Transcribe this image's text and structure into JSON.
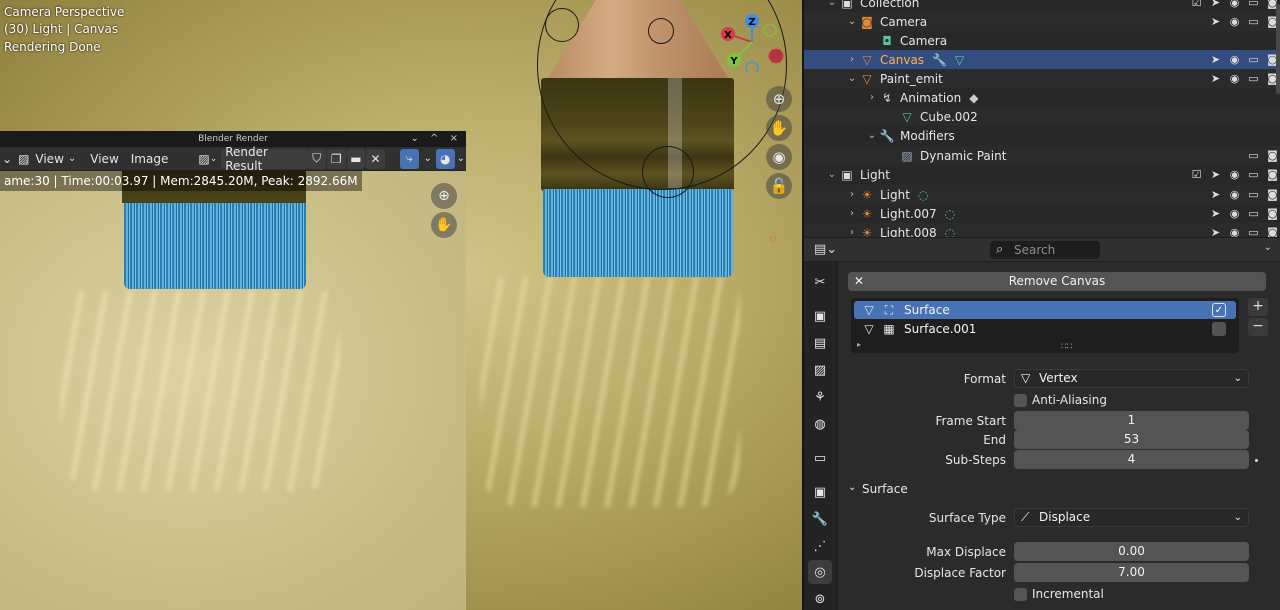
{
  "viewport": {
    "overlay_lines": [
      "Camera Perspective",
      "(30) Light | Canvas",
      "Rendering Done"
    ],
    "gizmo_axes": {
      "x": "X",
      "y": "Y",
      "z": "Z"
    },
    "colors": {
      "x_axis": "#d03c4c",
      "y_axis": "#7cc43c",
      "z_axis": "#3a8ee6"
    },
    "nav_icons": [
      "zoom-icon",
      "hand-icon",
      "camera-icon",
      "lock-icon"
    ]
  },
  "render_window": {
    "title": "Blender Render",
    "title_buttons": [
      "⌄",
      "^",
      "×"
    ],
    "toolbar": {
      "view_menu1": "View",
      "view_menu2": "View",
      "image_menu": "Image",
      "render_result": "Render Result"
    },
    "status": "ame:30 | Time:00:03.97 | Mem:2845.20M, Peak: 2892.66M"
  },
  "outliner": {
    "rows": [
      {
        "label": "Collection",
        "indent": 0
      },
      {
        "label": "Camera",
        "indent": 1
      },
      {
        "label": "Camera",
        "indent": 2
      },
      {
        "label": "Canvas",
        "indent": 1,
        "selected": true
      },
      {
        "label": "Paint_emit",
        "indent": 1
      },
      {
        "label": "Animation",
        "indent": 2
      },
      {
        "label": "Cube.002",
        "indent": 2
      },
      {
        "label": "Modifiers",
        "indent": 2
      },
      {
        "label": "Dynamic Paint",
        "indent": 3
      },
      {
        "label": "Light",
        "indent": 0
      },
      {
        "label": "Light",
        "indent": 1
      },
      {
        "label": "Light.007",
        "indent": 1
      },
      {
        "label": "Light.008",
        "indent": 1
      }
    ]
  },
  "properties": {
    "search_placeholder": "Search",
    "remove_button": "Remove Canvas",
    "surfaces": [
      {
        "label": "Surface",
        "enabled": true,
        "selected": true
      },
      {
        "label": "Surface.001",
        "enabled": false,
        "selected": false
      }
    ],
    "list_buttons": [
      "+",
      "−"
    ],
    "format": {
      "label": "Format",
      "value": "Vertex"
    },
    "anti_aliasing": {
      "label": "Anti-Aliasing",
      "checked": false
    },
    "frame_start": {
      "label": "Frame Start",
      "value": "1"
    },
    "end": {
      "label": "End",
      "value": "53"
    },
    "sub_steps": {
      "label": "Sub-Steps",
      "value": "4"
    },
    "surface_panel": "Surface",
    "surface_type": {
      "label": "Surface Type",
      "value": "Displace"
    },
    "max_displace": {
      "label": "Max Displace",
      "value": "0.00"
    },
    "displace_factor": {
      "label": "Displace Factor",
      "value": "7.00"
    },
    "incremental": {
      "label": "Incremental",
      "checked": false
    },
    "colors": {
      "accent": "#4772b3",
      "selected_row": "#334d80",
      "field": "#545454"
    }
  }
}
